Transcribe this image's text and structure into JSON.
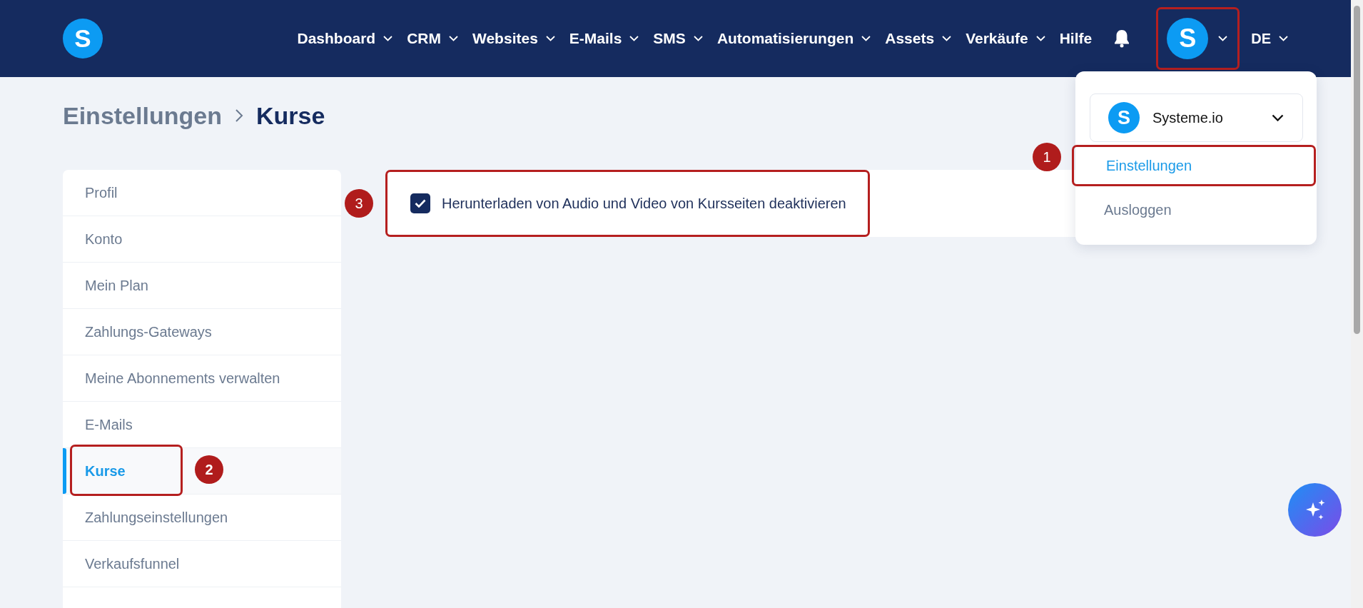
{
  "nav": {
    "logo_letter": "S",
    "items": [
      {
        "label": "Dashboard",
        "dropdown": true
      },
      {
        "label": "CRM",
        "dropdown": true
      },
      {
        "label": "Websites",
        "dropdown": true
      },
      {
        "label": "E-Mails",
        "dropdown": true
      },
      {
        "label": "SMS",
        "dropdown": true
      },
      {
        "label": "Automatisierungen",
        "dropdown": true
      },
      {
        "label": "Assets",
        "dropdown": true
      },
      {
        "label": "Verkäufe",
        "dropdown": true
      },
      {
        "label": "Hilfe",
        "dropdown": false
      }
    ],
    "avatar": {
      "letter": "S",
      "highlighted": true
    },
    "language": "DE"
  },
  "breadcrumb": [
    {
      "label": "Einstellungen",
      "current": false
    },
    {
      "label": "Kurse",
      "current": true
    }
  ],
  "sidebar": {
    "items": [
      {
        "label": "Profil",
        "selected": false
      },
      {
        "label": "Konto",
        "selected": false
      },
      {
        "label": "Mein Plan",
        "selected": false
      },
      {
        "label": "Zahlungs-Gateways",
        "selected": false
      },
      {
        "label": "Meine Abonnements verwalten",
        "selected": false
      },
      {
        "label": "E-Mails",
        "selected": false
      },
      {
        "label": "Kurse",
        "selected": true,
        "annotation": "2"
      },
      {
        "label": "Zahlungseinstellungen",
        "selected": false
      },
      {
        "label": "Verkaufsfunnel",
        "selected": false
      }
    ]
  },
  "setting": {
    "label": "Herunterladen von Audio und Video von Kursseiten deaktivieren",
    "checked": true,
    "annotation": "3"
  },
  "account_menu": {
    "account": {
      "letter": "S",
      "name": "Systeme.io"
    },
    "items": [
      {
        "label": "Einstellungen",
        "selected": true,
        "annotation": "1"
      },
      {
        "label": "Ausloggen",
        "selected": false
      }
    ]
  }
}
